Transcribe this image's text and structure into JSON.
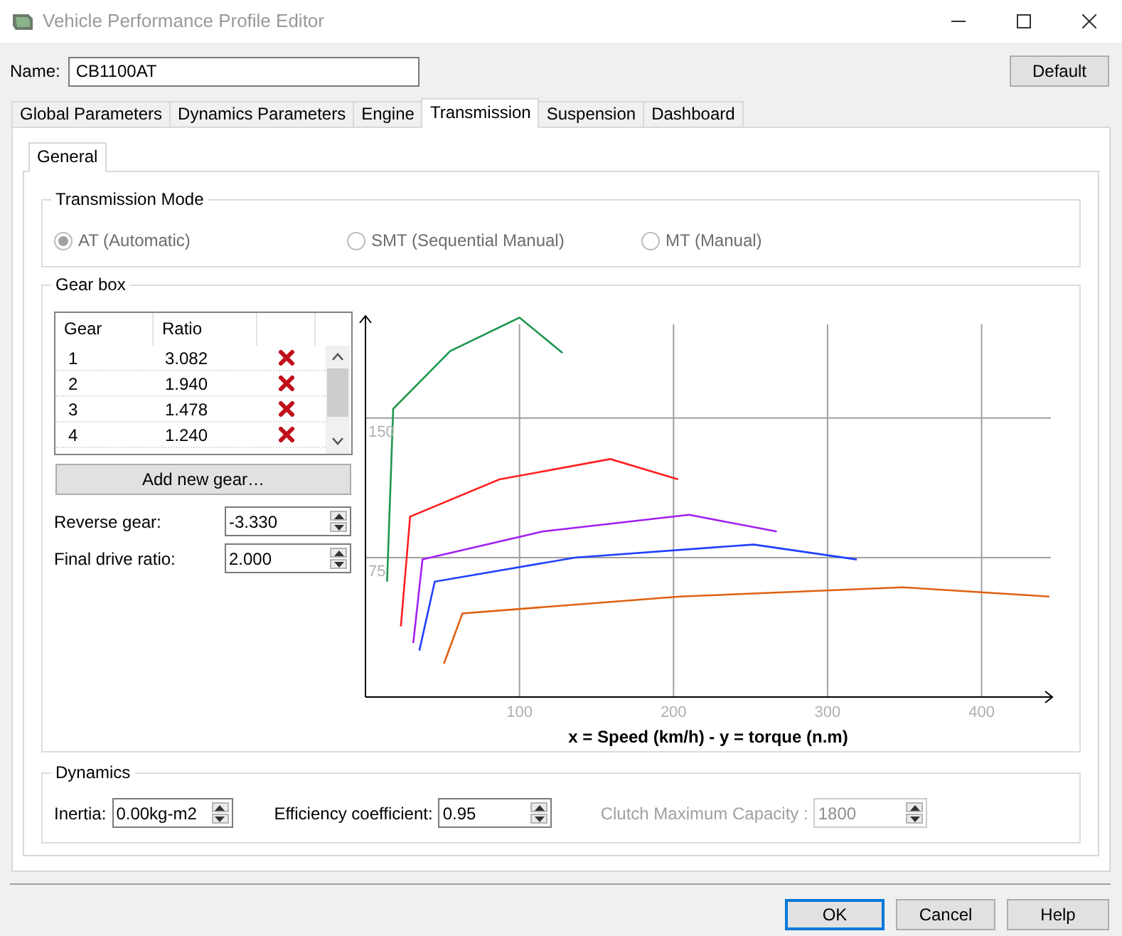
{
  "window": {
    "title": "Vehicle Performance Profile Editor"
  },
  "name_field": {
    "label": "Name:",
    "value": "CB1100AT"
  },
  "default_button": "Default",
  "tabs": [
    {
      "label": "Global Parameters",
      "selected": false
    },
    {
      "label": "Dynamics Parameters",
      "selected": false
    },
    {
      "label": "Engine",
      "selected": false
    },
    {
      "label": "Transmission",
      "selected": true
    },
    {
      "label": "Suspension",
      "selected": false
    },
    {
      "label": "Dashboard",
      "selected": false
    }
  ],
  "subtabs": [
    {
      "label": "General",
      "selected": true
    }
  ],
  "transmission_mode": {
    "title": "Transmission Mode",
    "options": [
      {
        "label": "AT (Automatic)",
        "selected": true,
        "disabled": true
      },
      {
        "label": "SMT (Sequential Manual)",
        "selected": false,
        "disabled": true
      },
      {
        "label": "MT (Manual)",
        "selected": false,
        "disabled": true
      }
    ]
  },
  "gear_box": {
    "title": "Gear box",
    "table": {
      "columns": [
        "Gear",
        "Ratio"
      ],
      "rows": [
        {
          "gear": "1",
          "ratio": "3.082"
        },
        {
          "gear": "2",
          "ratio": "1.940"
        },
        {
          "gear": "3",
          "ratio": "1.478"
        },
        {
          "gear": "4",
          "ratio": "1.240"
        }
      ]
    },
    "add_button": "Add new gear…",
    "fields": [
      {
        "label": "Reverse gear:",
        "value": "-3.330"
      },
      {
        "label": "Final drive ratio:",
        "value": "2.000"
      }
    ],
    "chart_data": {
      "type": "line",
      "grid": true,
      "xlabel": "x = Speed (km/h) - y = torque (n.m)",
      "xlim": [
        0,
        445
      ],
      "ylim": [
        0,
        205
      ],
      "xticks": [
        100,
        200,
        300,
        400
      ],
      "yticks": [
        75,
        150
      ],
      "series": [
        {
          "color": "#1e9650",
          "x": [
            14,
            18,
            55,
            100,
            128
          ],
          "values": [
            62,
            155,
            186,
            204,
            185
          ]
        },
        {
          "color": "#ff2020",
          "x": [
            23,
            29,
            87,
            159,
            203
          ],
          "values": [
            38,
            97,
            117,
            128,
            117
          ]
        },
        {
          "color": "#a020f0",
          "x": [
            31,
            37,
            115,
            210,
            267
          ],
          "values": [
            29,
            74,
            89,
            98,
            89
          ]
        },
        {
          "color": "#2040ff",
          "x": [
            35,
            45,
            136,
            252,
            319
          ],
          "values": [
            25,
            62,
            75,
            82,
            74
          ]
        },
        {
          "color": "#e06010",
          "x": [
            51,
            63,
            204,
            349,
            444
          ],
          "values": [
            18,
            45,
            54,
            59,
            54
          ]
        }
      ]
    }
  },
  "dynamics": {
    "title": "Dynamics",
    "fields": [
      {
        "label": "Inertia:",
        "value": "0.00kg-m2",
        "disabled": false
      },
      {
        "label": "Efficiency coefficient:",
        "value": "0.95",
        "disabled": false
      },
      {
        "label": "Clutch Maximum Capacity :",
        "value": "1800",
        "disabled": true
      }
    ]
  },
  "buttons": [
    "OK",
    "Cancel",
    "Help"
  ]
}
